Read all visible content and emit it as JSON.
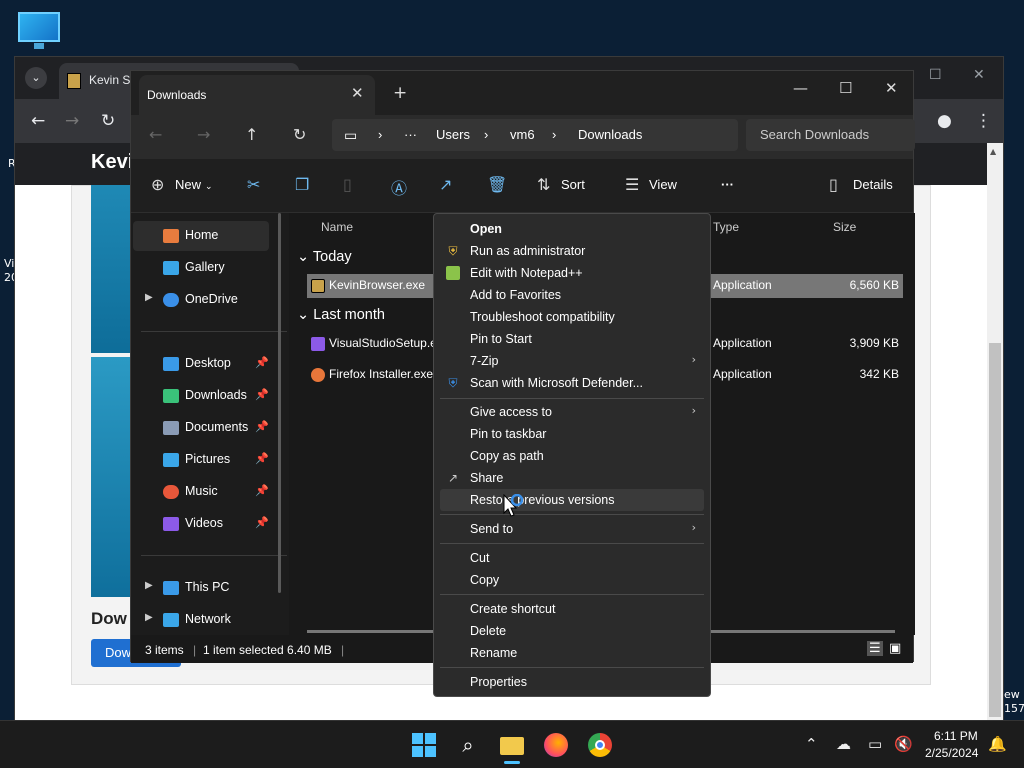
{
  "desktop": {
    "left_fragments": [
      "R",
      "Vi",
      "20"
    ],
    "right_fragments": [
      "ew",
      "157"
    ]
  },
  "browser": {
    "tab_title": "Kevin So",
    "page_heading": "Kevi",
    "section_heading": "Dow",
    "button_label": "Dow"
  },
  "explorer": {
    "tab_title": "Downloads",
    "breadcrumb": [
      "Users",
      "vm6",
      "Downloads"
    ],
    "breadcrumb_more": "···",
    "search_placeholder": "Search Downloads",
    "commands": {
      "new": "New",
      "sort": "Sort",
      "view": "View",
      "more": "···",
      "details": "Details"
    },
    "sidebar": [
      {
        "label": "Home",
        "icon": "home-icon",
        "color": "#e87c3e"
      },
      {
        "label": "Gallery",
        "icon": "gallery-icon",
        "color": "#3aa6e8"
      },
      {
        "label": "OneDrive",
        "icon": "onedrive-icon",
        "color": "#3a8fe8"
      },
      {
        "label": "Desktop",
        "icon": "desktop-icon",
        "color": "#3a9ae8"
      },
      {
        "label": "Downloads",
        "icon": "download-icon",
        "color": "#3ac27a"
      },
      {
        "label": "Documents",
        "icon": "documents-icon",
        "color": "#8a9bb5"
      },
      {
        "label": "Pictures",
        "icon": "pictures-icon",
        "color": "#3aa6e8"
      },
      {
        "label": "Music",
        "icon": "music-icon",
        "color": "#e8573a"
      },
      {
        "label": "Videos",
        "icon": "videos-icon",
        "color": "#8c5ae8"
      },
      {
        "label": "This PC",
        "icon": "pc-icon",
        "color": "#3a9ae8"
      },
      {
        "label": "Network",
        "icon": "network-icon",
        "color": "#3aa6e8"
      }
    ],
    "columns": {
      "name": "Name",
      "type": "Type",
      "size": "Size"
    },
    "groups": {
      "today": "Today",
      "last_month": "Last month"
    },
    "files": [
      {
        "name": "KevinBrowser.exe",
        "type": "Application",
        "size": "6,560 KB",
        "color": "#c9a24a"
      },
      {
        "name": "VisualStudioSetup.exe",
        "type": "Application",
        "size": "3,909 KB",
        "color": "#8c5ae8"
      },
      {
        "name": "Firefox Installer.exe",
        "type": "Application",
        "size": "342 KB",
        "color": "#e8763a"
      }
    ],
    "status": {
      "count": "3 items",
      "selected": "1 item selected  6.40 MB"
    }
  },
  "context_menu": {
    "open": "Open",
    "run_admin": "Run as administrator",
    "edit_notepad": "Edit with Notepad++",
    "add_favorites": "Add to Favorites",
    "troubleshoot": "Troubleshoot compatibility",
    "pin_start": "Pin to Start",
    "zip": "7-Zip",
    "scan_defender": "Scan with Microsoft Defender...",
    "give_access": "Give access to",
    "pin_taskbar": "Pin to taskbar",
    "copy_path": "Copy as path",
    "share": "Share",
    "restore_versions": "Restore previous versions",
    "send_to": "Send to",
    "cut": "Cut",
    "copy": "Copy",
    "create_shortcut": "Create shortcut",
    "delete": "Delete",
    "rename": "Rename",
    "properties": "Properties"
  },
  "taskbar": {
    "time": "6:11 PM",
    "date": "2/25/2024"
  }
}
